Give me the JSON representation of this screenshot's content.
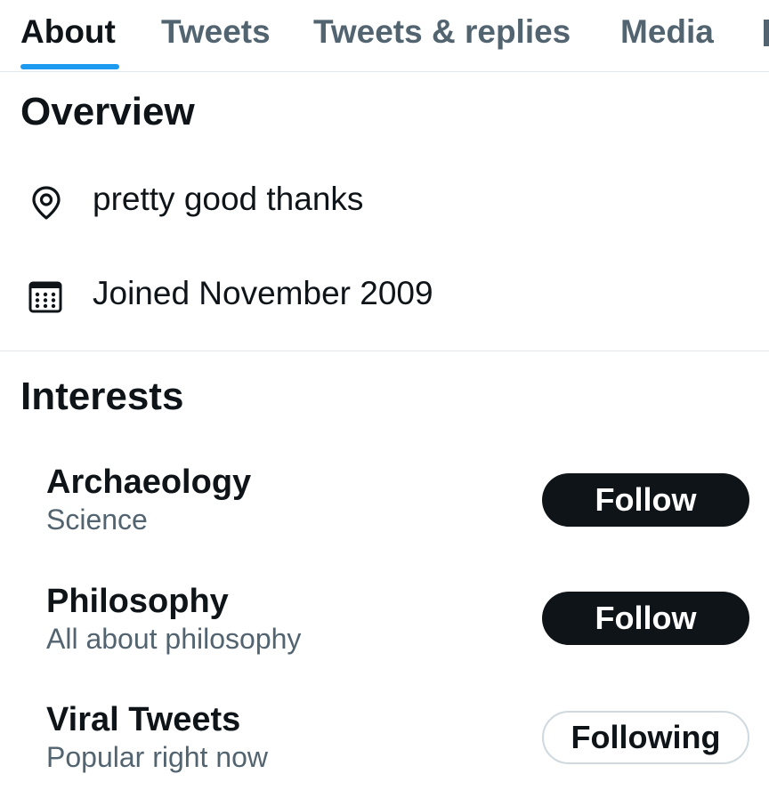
{
  "tabs": [
    {
      "label": "About",
      "active": true
    },
    {
      "label": "Tweets",
      "active": false
    },
    {
      "label": "Tweets & replies",
      "active": false
    },
    {
      "label": "Media",
      "active": false
    }
  ],
  "overview": {
    "title": "Overview",
    "location": {
      "icon": "location-pin-icon",
      "text": "pretty good thanks"
    },
    "joined": {
      "icon": "calendar-icon",
      "text": "Joined November 2009"
    }
  },
  "interests": {
    "title": "Interests",
    "items": [
      {
        "name": "Archaeology",
        "subtitle": "Science",
        "button": "Follow",
        "state": "follow"
      },
      {
        "name": "Philosophy",
        "subtitle": "All about philosophy",
        "button": "Follow",
        "state": "follow"
      },
      {
        "name": "Viral Tweets",
        "subtitle": "Popular right now",
        "button": "Following",
        "state": "following"
      }
    ]
  },
  "colors": {
    "accent": "#1d9bf0",
    "text_primary": "#0f1419",
    "text_secondary": "#536471",
    "divider": "#e1e8ed"
  }
}
